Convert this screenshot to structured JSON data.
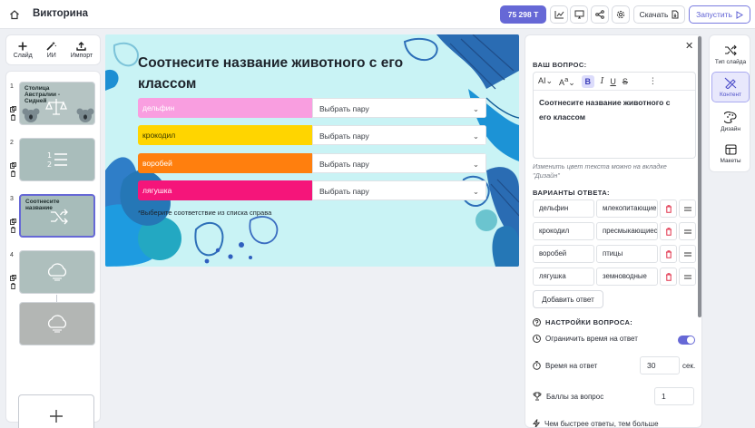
{
  "topbar": {
    "title": "Викторина",
    "coins": "75 298 T",
    "download": "Скачать",
    "run": "Запустить"
  },
  "tools": [
    {
      "label": "Слайд",
      "icon": "plus-icon"
    },
    {
      "label": "ИИ",
      "icon": "magic-wand-icon"
    },
    {
      "label": "Импорт",
      "icon": "upload-icon"
    }
  ],
  "slides": [
    {
      "num": "1",
      "title": "Столица Австралии - Сидней"
    },
    {
      "num": "2",
      "title": ""
    },
    {
      "num": "3",
      "title": "Соотнесите название"
    },
    {
      "num": "4",
      "title": ""
    }
  ],
  "canvas": {
    "title": "Соотнесите название животного с его классом",
    "placeholder": "Выбрать пару",
    "pairs": [
      {
        "word": "дельфин",
        "color": "#f99ee0"
      },
      {
        "word": "крокодил",
        "color": "#ffd500"
      },
      {
        "word": "воробей",
        "color": "#ff7f0e"
      },
      {
        "word": "лягушка",
        "color": "#f5157a"
      }
    ],
    "note": "*Выберите соответствие из списка справа"
  },
  "panel": {
    "question_label": "ВАШ ВОПРОС:",
    "question_text": "Соотнесите название животного с его классом",
    "hint": "Изменить цвет текста можно на вкладке \"Дизайн\"",
    "answers_label": "ВАРИАНТЫ ОТВЕТА:",
    "answers": [
      {
        "a": "дельфин",
        "b": "млекопитающие"
      },
      {
        "a": "крокодил",
        "b": "пресмыкающиеся"
      },
      {
        "a": "воробей",
        "b": "птицы"
      },
      {
        "a": "лягушка",
        "b": "земноводные"
      }
    ],
    "add_answer": "Добавить ответ",
    "settings_label": "НАСТРОЙКИ ВОПРОСА:",
    "limit_time": "Ограничить время на ответ",
    "time_label": "Время на ответ",
    "time_value": "30",
    "time_unit": "сек.",
    "points_label": "Баллы за вопрос",
    "points_value": "1",
    "faster_label": "Чем быстрее ответы, тем больше"
  },
  "sidebar": [
    {
      "label": "Тип слайда",
      "icon": "shuffle-icon"
    },
    {
      "label": "Контент",
      "icon": "pencil-ruler-icon"
    },
    {
      "label": "Дизайн",
      "icon": "palette-icon"
    },
    {
      "label": "Макеты",
      "icon": "layout-icon"
    }
  ]
}
